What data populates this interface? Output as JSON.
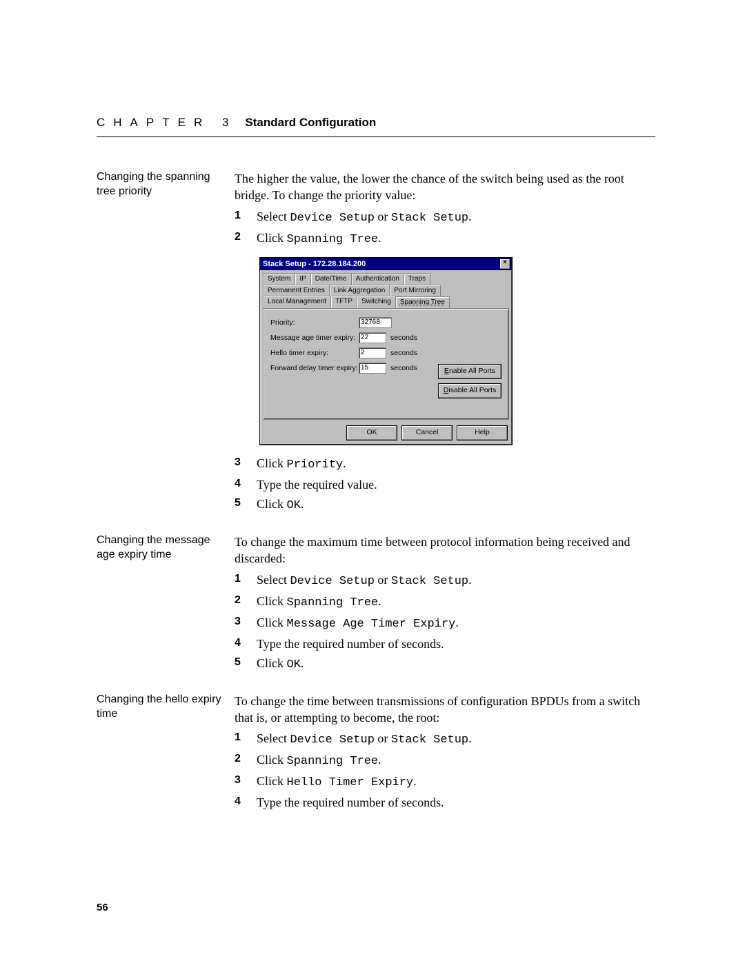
{
  "header": {
    "chapter_kicker": "CHAPTER 3",
    "chapter_title": "Standard Configuration"
  },
  "page_number": "56",
  "section1": {
    "label": "Changing the spanning tree priority",
    "intro": "The higher the value, the lower the chance of the switch being used as the root bridge. To change the priority value:",
    "steps": {
      "s1_a": "Select ",
      "s1_b": "Device Setup",
      "s1_c": " or ",
      "s1_d": "Stack Setup",
      "s1_e": ".",
      "s2_a": "Click ",
      "s2_b": "Spanning Tree",
      "s2_c": ".",
      "s3_a": "Click ",
      "s3_b": "Priority",
      "s3_c": ".",
      "s4": "Type the required value.",
      "s5_a": "Click ",
      "s5_b": "OK",
      "s5_c": "."
    }
  },
  "dialog": {
    "title": "Stack Setup - 172.28.184.200",
    "close": "×",
    "tabs_row1": [
      "System",
      "IP",
      "Date/Time",
      "Authentication",
      "Traps"
    ],
    "tabs_row2": [
      "Permanent Entries",
      "Link Aggregation",
      "Port Mirroring"
    ],
    "tabs_row3": [
      "Local Management",
      "TFTP",
      "Switching",
      "Spanning Tree"
    ],
    "fields": {
      "priority_label": "Priority:",
      "priority_value": "32768",
      "msg_label": "Message age timer expiry:",
      "msg_value": "22",
      "hello_label": "Hello timer expiry:",
      "hello_value": "2",
      "fwd_label": "Forward delay timer expiry:",
      "fwd_value": "15",
      "unit": "seconds"
    },
    "enable_btn_u": "E",
    "enable_btn_rest": "nable All Ports",
    "disable_btn_u": "D",
    "disable_btn_rest": "isable All Ports",
    "ok": "OK",
    "cancel": "Cancel",
    "help": "Help"
  },
  "section2": {
    "label": "Changing the message age expiry time",
    "intro": "To change the maximum time between protocol information being received and discarded:",
    "steps": {
      "s1_a": "Select ",
      "s1_b": "Device Setup",
      "s1_c": " or ",
      "s1_d": "Stack Setup",
      "s1_e": ".",
      "s2_a": "Click ",
      "s2_b": "Spanning Tree",
      "s2_c": ".",
      "s3_a": "Click ",
      "s3_b": "Message Age Timer Expiry",
      "s3_c": ".",
      "s4": "Type the required number of seconds.",
      "s5_a": "Click ",
      "s5_b": "OK",
      "s5_c": "."
    }
  },
  "section3": {
    "label": "Changing the hello expiry time",
    "intro": "To change the time between transmissions of configuration BPDUs from a switch that is, or attempting to become, the root:",
    "steps": {
      "s1_a": "Select ",
      "s1_b": "Device Setup",
      "s1_c": " or ",
      "s1_d": "Stack Setup",
      "s1_e": ".",
      "s2_a": "Click ",
      "s2_b": "Spanning Tree",
      "s2_c": ".",
      "s3_a": "Click ",
      "s3_b": "Hello Timer Expiry",
      "s3_c": ".",
      "s4": "Type the required number of seconds."
    }
  }
}
